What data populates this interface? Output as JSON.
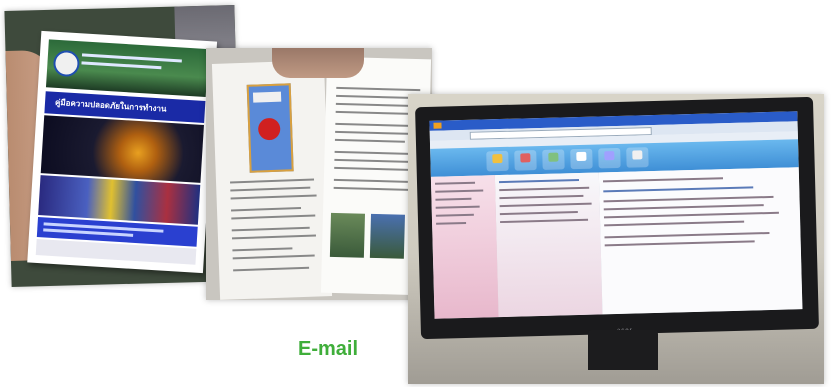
{
  "caption": {
    "text": "E-mail",
    "color": "#3fae3a"
  },
  "booklet_cover": {
    "title_text": "คู่มือความปลอดภัยในการทำงาน"
  },
  "monitor": {
    "brand_text": "acer"
  }
}
